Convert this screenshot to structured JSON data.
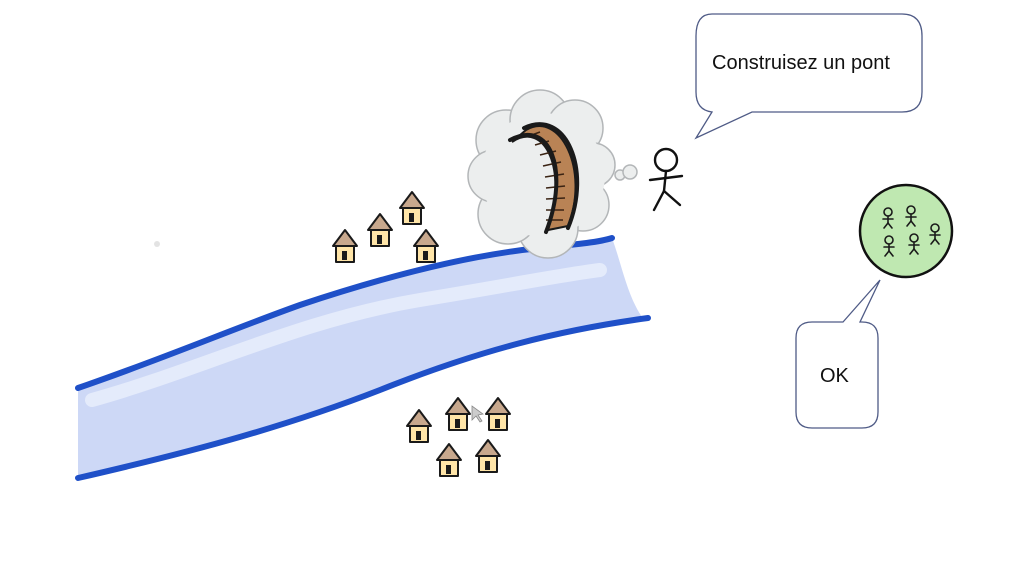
{
  "speech_bubble": {
    "text": "Construisez un pont"
  },
  "reply_bubble": {
    "text": "OK"
  },
  "colors": {
    "river_edge": "#1f50c8",
    "river_fill": "#cdd8f6",
    "bridge_wood": "#b98355",
    "thought_cloud": "#eceeee",
    "crowd_fill": "#bfe8b1",
    "crowd_stroke": "#111111",
    "house_roof": "#c8a88d",
    "house_wall": "#ffe5a8",
    "bubble_stroke": "#4f5b86"
  },
  "icons": {
    "person": "stick-figure-icon",
    "bridge": "bridge-icon",
    "house": "house-icon",
    "crowd": "group-of-people-icon",
    "cloud": "thought-cloud-icon"
  }
}
